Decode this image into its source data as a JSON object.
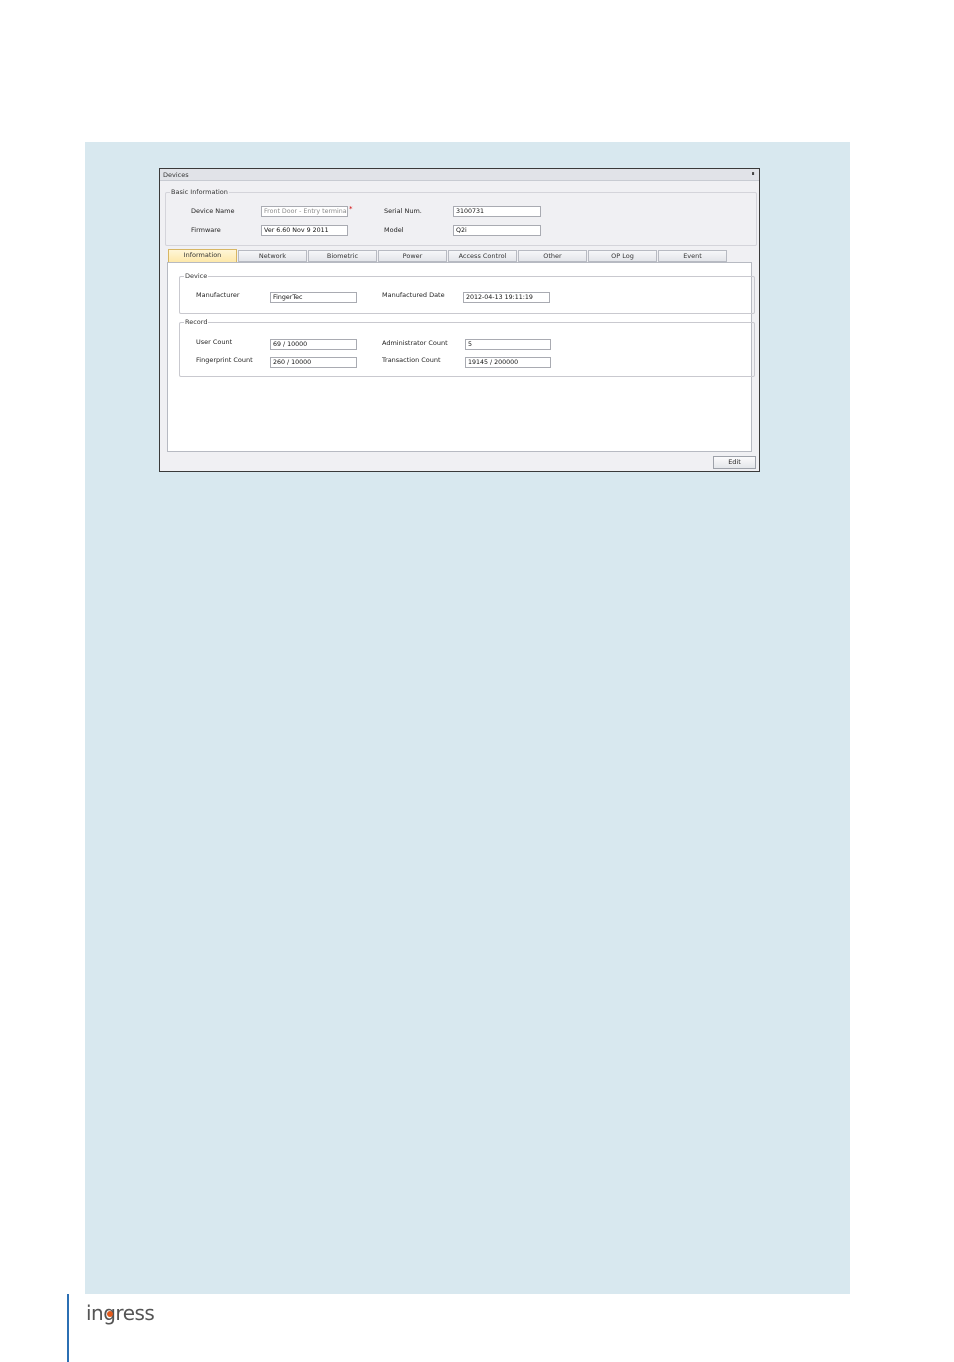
{
  "window": {
    "title": "Devices",
    "pin_icon": "pin-icon"
  },
  "basic_info": {
    "legend": "Basic Information",
    "device_name": {
      "label": "Device Name",
      "value": "Front Door - Entry terminal",
      "required_mark": "*"
    },
    "serial_num": {
      "label": "Serial Num.",
      "value": "3100731"
    },
    "firmware": {
      "label": "Firmware",
      "value": "Ver 6.60 Nov  9 2011"
    },
    "model": {
      "label": "Model",
      "value": "Q2i"
    }
  },
  "tabs": [
    {
      "label": "Information",
      "active": true
    },
    {
      "label": "Network"
    },
    {
      "label": "Biometric"
    },
    {
      "label": "Power"
    },
    {
      "label": "Access Control"
    },
    {
      "label": "Other"
    },
    {
      "label": "OP Log"
    },
    {
      "label": "Event"
    }
  ],
  "device_group": {
    "legend": "Device",
    "manufacturer": {
      "label": "Manufacturer",
      "value": "FingerTec"
    },
    "manufactured_date": {
      "label": "Manufactured Date",
      "value": "2012-04-13 19:11:19"
    }
  },
  "record_group": {
    "legend": "Record",
    "user_count": {
      "label": "User Count",
      "value": "69 / 10000"
    },
    "admin_count": {
      "label": "Administrator Count",
      "value": "5"
    },
    "fingerprint_count": {
      "label": "Fingerprint Count",
      "value": "260 / 10000"
    },
    "transaction_count": {
      "label": "Transaction Count",
      "value": "19145 / 200000"
    }
  },
  "actions": {
    "edit_label": "Edit"
  },
  "footer": {
    "logo_text": "ingress"
  },
  "colors": {
    "panel_bg": "#d8e8ef",
    "active_tab": "#fde7a6",
    "required": "#d00000",
    "logo_accent": "#e25a1c",
    "footer_rule": "#2b6fb3"
  }
}
